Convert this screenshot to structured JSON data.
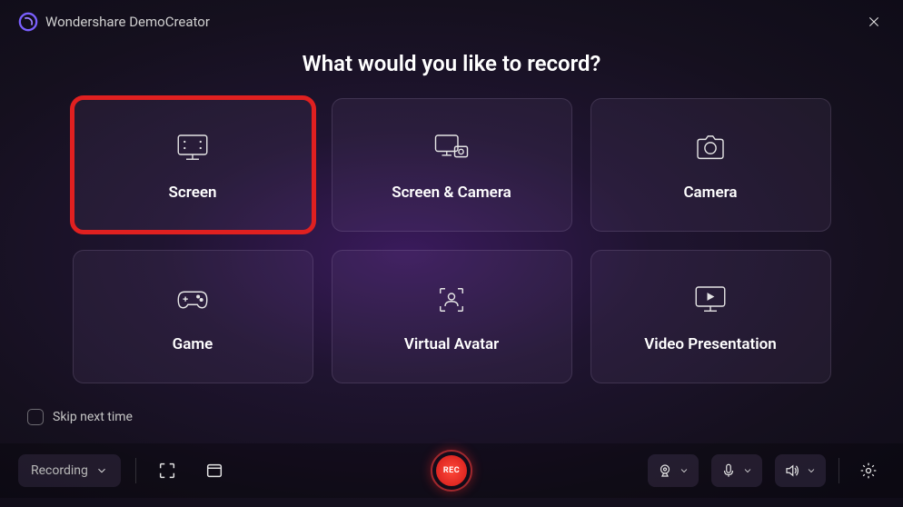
{
  "header": {
    "app_name": "Wondershare DemoCreator"
  },
  "title": "What would you like to record?",
  "cards": [
    {
      "label": "Screen",
      "highlighted": true
    },
    {
      "label": "Screen & Camera"
    },
    {
      "label": "Camera"
    },
    {
      "label": "Game"
    },
    {
      "label": "Virtual Avatar"
    },
    {
      "label": "Video Presentation"
    }
  ],
  "skip": {
    "label": "Skip next time",
    "checked": false
  },
  "toolbar": {
    "mode_label": "Recording",
    "rec_label": "REC"
  }
}
